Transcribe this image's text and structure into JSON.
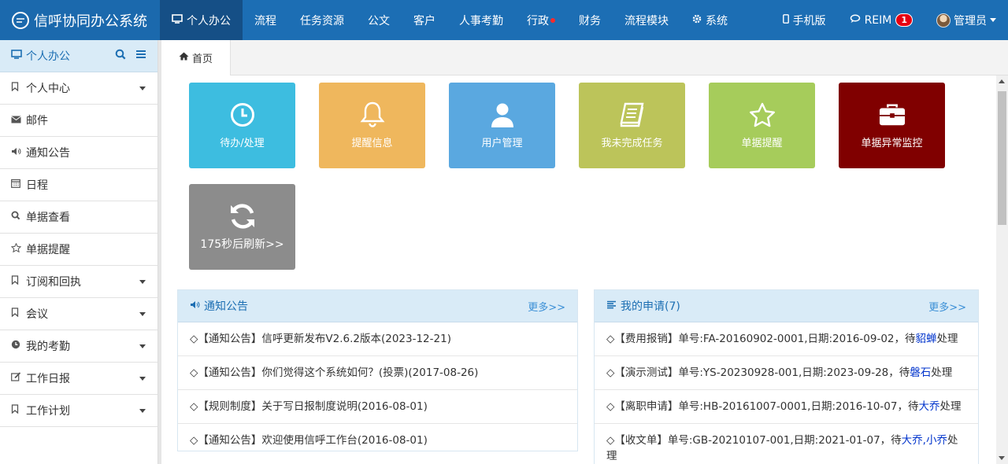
{
  "brand": {
    "title": "信呼协同办公系统"
  },
  "nav": {
    "items": [
      {
        "label": "个人办公",
        "icon": "monitor-icon"
      },
      {
        "label": "流程"
      },
      {
        "label": "任务资源"
      },
      {
        "label": "公文"
      },
      {
        "label": "客户"
      },
      {
        "label": "人事考勤"
      },
      {
        "label": "行政"
      },
      {
        "label": "财务"
      },
      {
        "label": "流程模块"
      },
      {
        "label": "系统",
        "icon": "gear-icon"
      }
    ],
    "mobile": "手机版",
    "reim": "REIM",
    "reim_badge": "1",
    "user": "管理员"
  },
  "sidebar": {
    "head": "个人办公",
    "items": [
      {
        "label": "个人中心",
        "icon": "bookmark-icon",
        "expand": true
      },
      {
        "label": "邮件",
        "icon": "envelope-icon"
      },
      {
        "label": "通知公告",
        "icon": "volume-icon"
      },
      {
        "label": "日程",
        "icon": "calendar-icon"
      },
      {
        "label": "单据查看",
        "icon": "search-icon"
      },
      {
        "label": "单据提醒",
        "icon": "star-icon"
      },
      {
        "label": "订阅和回执",
        "icon": "bookmark-icon",
        "expand": true
      },
      {
        "label": "会议",
        "icon": "bookmark-icon",
        "expand": true
      },
      {
        "label": "我的考勤",
        "icon": "clock-icon",
        "expand": true
      },
      {
        "label": "工作日报",
        "icon": "edit-icon",
        "expand": true
      },
      {
        "label": "工作计划",
        "icon": "bookmark-icon",
        "expand": true
      }
    ]
  },
  "tabs": {
    "home": "首页"
  },
  "tiles": [
    {
      "label": "待办/处理",
      "color": "#3dbde0",
      "icon": "clock-icon"
    },
    {
      "label": "提醒信息",
      "color": "#efb75d",
      "icon": "bell-icon"
    },
    {
      "label": "用户管理",
      "color": "#5aa8e0",
      "icon": "user-icon"
    },
    {
      "label": "我未完成任务",
      "color": "#bcc45a",
      "icon": "book-icon"
    },
    {
      "label": "单据提醒",
      "color": "#a6cc5b",
      "icon": "star-icon"
    },
    {
      "label": "单据异常监控",
      "color": "#800000",
      "icon": "briefcase-icon"
    },
    {
      "label": "175秒后刷新>>",
      "color": "#8c8c8c",
      "icon": "refresh-icon"
    }
  ],
  "notice": {
    "title": "通知公告",
    "more": "更多>>",
    "rows": [
      "◇【通知公告】信呼更新发布V2.6.2版本(2023-12-21)",
      "◇【通知公告】你们觉得这个系统如何？(投票)(2017-08-26)",
      "◇【规则制度】关于写日报制度说明(2016-08-01)",
      "◇【通知公告】欢迎使用信呼工作台(2016-08-01)"
    ]
  },
  "apply": {
    "title": "我的申请(7)",
    "more": "更多>>",
    "rows": [
      {
        "text": "◇【费用报销】单号:FA-20160902-0001,日期:2016-09-02，待",
        "who": "貂蝉",
        "tail": "处理"
      },
      {
        "text": "◇【演示测试】单号:YS-20230928-001,日期:2023-09-28，待",
        "who": "磐石",
        "tail": "处理"
      },
      {
        "text": "◇【离职申请】单号:HB-20161007-0001,日期:2016-10-07，待",
        "who": "大乔",
        "tail": "处理"
      },
      {
        "text": "◇【收文单】单号:GB-20210107-001,日期:2021-01-07，待",
        "who": "大乔,小乔",
        "tail": "处理"
      }
    ]
  }
}
